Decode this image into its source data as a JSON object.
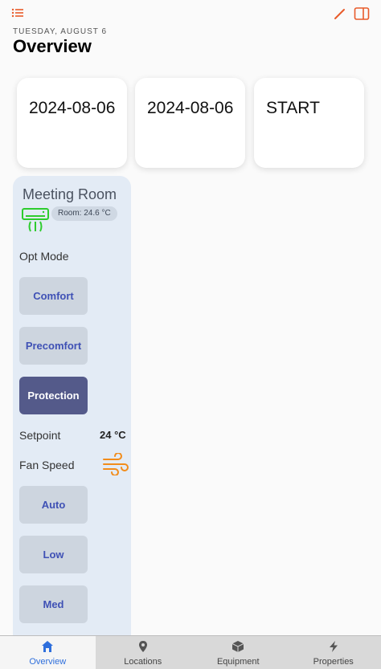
{
  "header": {
    "date": "TUESDAY, AUGUST 6",
    "title": "Overview"
  },
  "cards": [
    {
      "label": "2024-08-06"
    },
    {
      "label": "2024-08-06"
    },
    {
      "label": "START"
    }
  ],
  "room": {
    "name": "Meeting Room",
    "badge": "Room: 24.6 °C",
    "opt_mode_label": "Opt Mode",
    "modes": [
      "Comfort",
      "Precomfort",
      "Protection"
    ],
    "active_mode": "Protection",
    "setpoint_label": "Setpoint",
    "setpoint_value": "24 °C",
    "fan_label": "Fan Speed",
    "fan_speeds": [
      "Auto",
      "Low",
      "Med"
    ]
  },
  "tabs": [
    {
      "label": "Overview",
      "icon": "home-icon",
      "active": true
    },
    {
      "label": "Locations",
      "icon": "map-pin-icon",
      "active": false
    },
    {
      "label": "Equipment",
      "icon": "box-icon",
      "active": false
    },
    {
      "label": "Properties",
      "icon": "bolt-icon",
      "active": false
    }
  ],
  "colors": {
    "accent": "#e85a2a",
    "ac_icon": "#2ecc2e",
    "fan_icon": "#f28c1a",
    "active_mode_bg": "#545a8a",
    "tab_active": "#2f6fdc"
  }
}
